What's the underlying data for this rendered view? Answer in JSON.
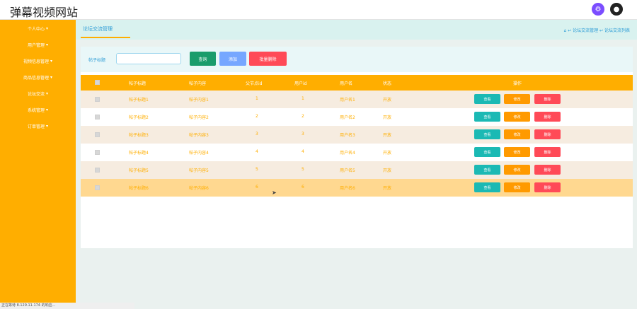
{
  "app": {
    "title": "弹幕视频网站"
  },
  "sidebar": {
    "items": [
      {
        "label": "个人中心"
      },
      {
        "label": "用户管理"
      },
      {
        "label": "视频信息管理"
      },
      {
        "label": "商品信息管理"
      },
      {
        "label": "论坛交流"
      },
      {
        "label": "系统管理"
      },
      {
        "label": "订单管理"
      }
    ]
  },
  "breadcrumb": {
    "title": "论坛交流管理",
    "path": "⌂ ↩ 论坛交流管理 ↩ 论坛交流列表"
  },
  "search": {
    "label": "帖子标题",
    "placeholder": "",
    "buttons": {
      "search": "查询",
      "add": "添加",
      "batch_delete": "批量删除"
    }
  },
  "table": {
    "headers": [
      "帖子标题",
      "帖子内容",
      "父节点id",
      "用户id",
      "用户名",
      "状态",
      "操作"
    ],
    "rows": [
      {
        "title": "帖子标题1",
        "content": "帖子内容1",
        "parent": "1",
        "uid": "1",
        "user": "用户名1",
        "status": "开放"
      },
      {
        "title": "帖子标题2",
        "content": "帖子内容2",
        "parent": "2",
        "uid": "2",
        "user": "用户名2",
        "status": "开放"
      },
      {
        "title": "帖子标题3",
        "content": "帖子内容3",
        "parent": "3",
        "uid": "3",
        "user": "用户名3",
        "status": "开放"
      },
      {
        "title": "帖子标题4",
        "content": "帖子内容4",
        "parent": "4",
        "uid": "4",
        "user": "用户名4",
        "status": "开放"
      },
      {
        "title": "帖子标题5",
        "content": "帖子内容5",
        "parent": "5",
        "uid": "5",
        "user": "用户名5",
        "status": "开放"
      },
      {
        "title": "帖子标题6",
        "content": "帖子内容6",
        "parent": "6",
        "uid": "6",
        "user": "用户名6",
        "status": "开放"
      }
    ],
    "actions": {
      "view": "查看",
      "edit": "修改",
      "delete": "删除"
    }
  },
  "statusbar": {
    "text": "正在等待 8.129.11.174 的响应..."
  },
  "icons": [
    "settings-icon",
    "user-icon",
    "checkbox-icon",
    "home-icon"
  ],
  "colors": {
    "accent": "#ffae00",
    "teal": "#1bb9b4",
    "red": "#ff4a57"
  }
}
